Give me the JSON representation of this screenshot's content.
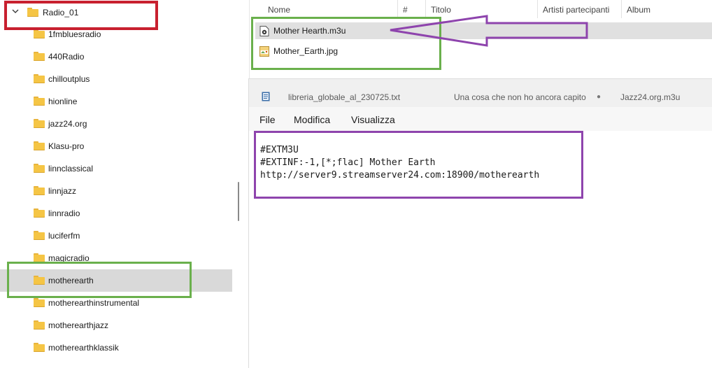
{
  "tree": {
    "root": {
      "label": "Radio_01",
      "expanded": true
    },
    "items": [
      {
        "label": "1fmbluesradio"
      },
      {
        "label": "440Radio"
      },
      {
        "label": "chilloutplus"
      },
      {
        "label": "hionline"
      },
      {
        "label": "jazz24.org"
      },
      {
        "label": "Klasu-pro"
      },
      {
        "label": "linnclassical"
      },
      {
        "label": "linnjazz"
      },
      {
        "label": "linnradio"
      },
      {
        "label": "luciferfm"
      },
      {
        "label": "magicradio"
      },
      {
        "label": "motherearth",
        "selected": true
      },
      {
        "label": "motherearthinstrumental"
      },
      {
        "label": "motherearthjazz"
      },
      {
        "label": "motherearthklassik"
      }
    ]
  },
  "filelist": {
    "columns": {
      "name": "Nome",
      "track": "#",
      "title": "Titolo",
      "artists": "Artisti partecipanti",
      "album": "Album"
    },
    "files": [
      {
        "name": "Mother Hearth.m3u",
        "icon": "m3u-file-icon",
        "selected": true
      },
      {
        "name": "Mother_Earth.jpg",
        "icon": "jpg-file-icon"
      }
    ]
  },
  "notepad": {
    "tabs": [
      {
        "label": "libreria_globale_al_230725.txt"
      },
      {
        "label": "Una cosa che non ho ancora capito"
      },
      {
        "label": "●",
        "kind": "unsaved-dot"
      },
      {
        "label": "Jazz24.org.m3u"
      }
    ],
    "menu": {
      "file": "File",
      "edit": "Modifica",
      "view": "Visualizza"
    },
    "lines": [
      "#EXTM3U",
      "#EXTINF:-1,[*;flac] Mother Earth",
      "http://server9.streamserver24.com:18900/motherearth"
    ]
  },
  "colors": {
    "annotation_red": "#c8202f",
    "annotation_green": "#6ab04c",
    "annotation_purple": "#8e44ad",
    "folder_yellow": "#f5c545",
    "selection_gray": "#d9d9d9"
  }
}
